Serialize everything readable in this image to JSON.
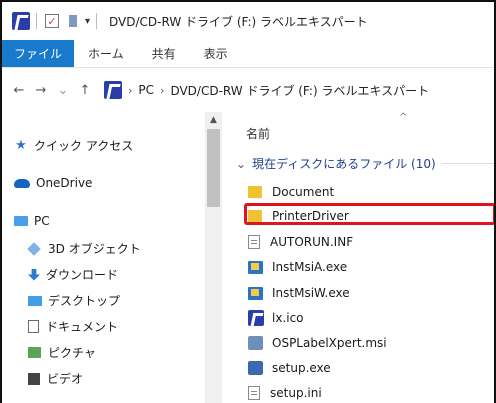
{
  "titlebar": {
    "check_glyph": "✓",
    "qa_arrow": "▾",
    "title": "DVD/CD-RW ドライブ (F:) ラベルエキスパート"
  },
  "ribbon": {
    "tabs": [
      "ファイル",
      "ホーム",
      "共有",
      "表示"
    ]
  },
  "address": {
    "back": "←",
    "forward": "→",
    "recent": "⌄",
    "up": "↑",
    "separator": "›",
    "crumbs": [
      "PC",
      "DVD/CD-RW ドライブ (F:) ラベルエキスパート"
    ]
  },
  "navpane": {
    "items": [
      {
        "label": "クイック アクセス",
        "icon": "star-icon"
      },
      {
        "label": "OneDrive",
        "icon": "cloud-icon"
      },
      {
        "label": "PC",
        "icon": "pc-icon"
      },
      {
        "label": "3D オブジェクト",
        "icon": "3d-objects-icon"
      },
      {
        "label": "ダウンロード",
        "icon": "download-icon"
      },
      {
        "label": "デスクトップ",
        "icon": "desktop-icon"
      },
      {
        "label": "ドキュメント",
        "icon": "document-icon"
      },
      {
        "label": "ピクチャ",
        "icon": "pictures-icon"
      },
      {
        "label": "ビデオ",
        "icon": "video-icon"
      }
    ],
    "star_glyph": "★"
  },
  "scrollbar": {
    "up_glyph": "▲"
  },
  "filepane": {
    "sort_caret": "^",
    "column_name": "名前",
    "group_chevron": "⌄",
    "group_label": "現在ディスクにあるファイル (10)",
    "files": [
      {
        "name": "Document",
        "icon": "folder-icon"
      },
      {
        "name": "PrinterDriver",
        "icon": "folder-icon"
      },
      {
        "name": "AUTORUN.INF",
        "icon": "file-icon"
      },
      {
        "name": "InstMsiA.exe",
        "icon": "installer-icon"
      },
      {
        "name": "InstMsiW.exe",
        "icon": "installer-icon"
      },
      {
        "name": "lx.ico",
        "icon": "label-expert-icon"
      },
      {
        "name": "OSPLabelXpert.msi",
        "icon": "package-icon"
      },
      {
        "name": "setup.exe",
        "icon": "setup-icon"
      },
      {
        "name": "setup.ini",
        "icon": "file-icon"
      }
    ]
  },
  "highlight_color": "#e0141b"
}
